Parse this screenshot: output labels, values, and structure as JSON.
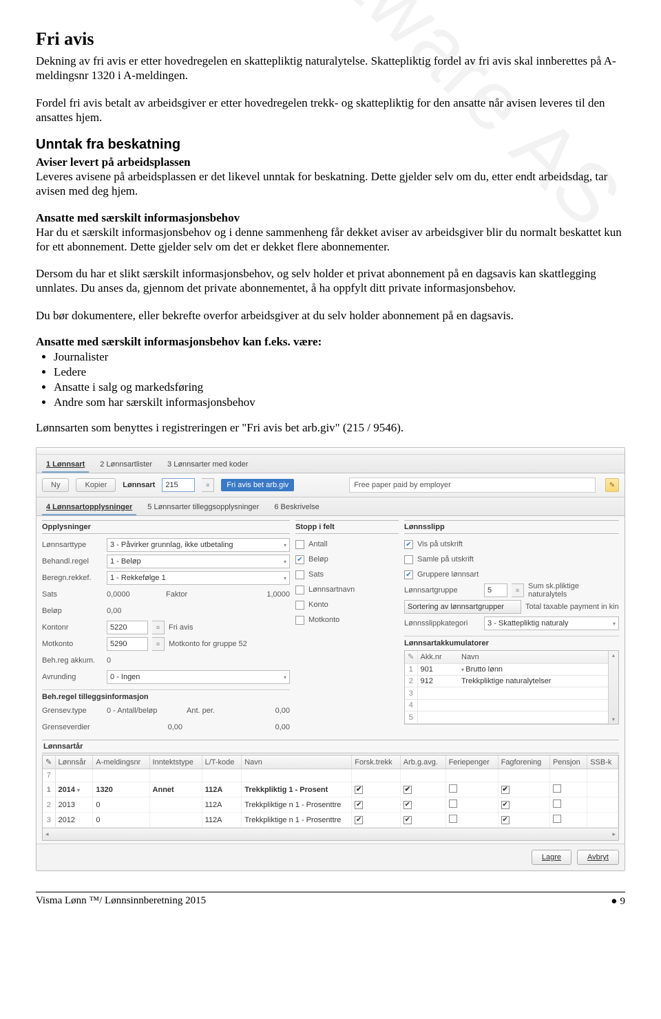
{
  "page": {
    "title": "Fri avis",
    "p1": "Dekning av fri avis er etter hovedregelen en skattepliktig naturalytelse. Skattepliktig fordel av fri avis skal innberettes på A-meldingsnr 1320 i A-meldingen.",
    "p2": "Fordel fri avis betalt av arbeidsgiver er etter hovedregelen trekk- og skattepliktig for den ansatte når avisen leveres til den ansattes hjem.",
    "h2": "Unntak fra beskatning",
    "h3a": "Aviser levert på arbeidsplassen",
    "p3": "Leveres avisene på arbeidsplassen er det likevel unntak for beskatning. Dette gjelder selv om du, etter endt arbeidsdag, tar avisen med deg hjem.",
    "h3b": "Ansatte med særskilt informasjonsbehov",
    "p4": "Har du et særskilt informasjonsbehov og i denne sammenheng får dekket aviser av arbeidsgiver blir du normalt beskattet kun for ett abonnement. Dette gjelder selv om det er dekket flere abonnementer.",
    "p5": "Dersom du har et slikt særskilt informasjonsbehov, og selv holder et privat abonnement på en dagsavis kan skattlegging unnlates. Du anses da, gjennom det private abonnementet, å ha oppfylt ditt private informasjonsbehov.",
    "p6": "Du bør dokumentere, eller bekrefte overfor arbeidsgiver at du selv holder abonnement på en dagsavis.",
    "h3c": "Ansatte med særskilt informasjonsbehov kan f.eks. være:",
    "bullets": [
      "Journalister",
      "Ledere",
      "Ansatte i salg og markedsføring",
      "Andre som har særskilt informasjonsbehov"
    ],
    "p7": "Lønnsarten som benyttes i registreringen er \"Fri avis bet arb.giv\" (215 / 9546).",
    "footer_left": "Visma Lønn ™/ Lønnsinnberetning 2015",
    "footer_right": "9",
    "watermark": "Visma Software AS"
  },
  "app": {
    "top_tabs": [
      "1 Lønnsart",
      "2 Lønnsartlister",
      "3 Lønnsarter med koder"
    ],
    "toolbar": {
      "ny": "Ny",
      "kopier": "Kopier",
      "lbl": "Lønnsart",
      "num": "215",
      "seltag": "Fri avis bet arb.giv",
      "free": "Free paper paid by employer"
    },
    "sub_tabs": [
      "4 Lønnsartopplysninger",
      "5 Lønnsarter tilleggsopplysninger",
      "6 Beskrivelse"
    ],
    "left": {
      "title": "Opplysninger",
      "rows": [
        {
          "n": "Lønnsarttype",
          "v": "3 - Påvirker grunnlag, ikke utbetaling",
          "dd": true
        },
        {
          "n": "Behandl.regel",
          "v": "1 - Beløp",
          "dd": true
        },
        {
          "n": "Beregn.rekkef.",
          "v": "1 - Rekkefølge 1",
          "dd": true
        },
        {
          "n": "Sats",
          "v": "0,0000",
          "extra_lbl": "Faktor",
          "extra_v": "1,0000"
        },
        {
          "n": "Beløp",
          "v": "0,00"
        },
        {
          "n": "Kontonr",
          "v": "5220",
          "list": true,
          "gray": "Fri avis"
        },
        {
          "n": "Motkonto",
          "v": "5290",
          "list": true,
          "gray": "Motkonto for gruppe 52"
        },
        {
          "n": "Beh.reg akkum.",
          "v": "0"
        },
        {
          "n": "Avrunding",
          "v": "0 - Ingen",
          "dd": true
        }
      ],
      "sub": "Beh.regel tilleggsinformasjon",
      "subrows": [
        {
          "n": "Grensev.type",
          "v": "0 - Antall/beløp",
          "extra_lbl": "Ant. per.",
          "extra_v": "0,00"
        },
        {
          "n": "Grenseverdier",
          "v": "",
          "extra_lbl": "0,00",
          "extra_v": "0,00"
        }
      ]
    },
    "mid": {
      "title": "Stopp i felt",
      "checks": [
        {
          "l": "Antall",
          "c": false
        },
        {
          "l": "Beløp",
          "c": true
        },
        {
          "l": "Sats",
          "c": false
        },
        {
          "l": "Lønnsartnavn",
          "c": false
        },
        {
          "l": "Konto",
          "c": false
        },
        {
          "l": "Motkonto",
          "c": false
        }
      ]
    },
    "right": {
      "title": "Lønnsslipp",
      "checks": [
        {
          "l": "Vis på utskrift",
          "c": true
        },
        {
          "l": "Samle på utskrift",
          "c": false
        },
        {
          "l": "Gruppere lønnsart",
          "c": true
        }
      ],
      "grpnum_lbl": "Lønnsartgruppe",
      "grpnum": "5",
      "grpnum_gray": "Sum sk.pliktige naturalytels",
      "sortbtn": "Sortering av lønnsartgrupper",
      "sortgray": "Total taxable payment in kin",
      "kat_lbl": "Lønnsslippkategori",
      "kat": "3 - Skattepliktig naturaly",
      "akk_title": "Lønnsartakkumulatorer",
      "akk_head": [
        "Akk.nr",
        "Navn"
      ],
      "akk_rows": [
        {
          "nr": "901",
          "navn": "Brutto lønn"
        },
        {
          "nr": "912",
          "navn": "Trekkpliktige naturalytelser"
        }
      ]
    },
    "la": {
      "title": "Lønnsartår",
      "cols": [
        "Lønnsår",
        "A-meldingsnr",
        "Inntektstype",
        "L/T-kode",
        "Navn",
        "Forsk.trekk",
        "Arb.g.avg.",
        "Feriepenger",
        "Fagforening",
        "Pensjon",
        "SSB-k"
      ],
      "rows": [
        {
          "n": "7",
          "y": "",
          "am": "",
          "it": "",
          "lt": "",
          "nv": "",
          "ft": "",
          "ag": "",
          "fp": "",
          "fg": "",
          "pe": ""
        },
        {
          "n": "1",
          "y": "2014",
          "am": "1320",
          "it": "Annet",
          "lt": "112A",
          "nv": "Trekkpliktig 1 - Prosent",
          "ft": "y",
          "ag": "y",
          "fp": "",
          "fg": "y",
          "pe": "",
          "sel": true
        },
        {
          "n": "2",
          "y": "2013",
          "am": "0",
          "it": "",
          "lt": "112A",
          "nv": "Trekkpliktige n 1 - Prosenttre",
          "ft": "y",
          "ag": "y",
          "fp": "",
          "fg": "y",
          "pe": ""
        },
        {
          "n": "3",
          "y": "2012",
          "am": "0",
          "it": "",
          "lt": "112A",
          "nv": "Trekkpliktige n 1 - Prosenttre",
          "ft": "y",
          "ag": "y",
          "fp": "",
          "fg": "y",
          "pe": ""
        }
      ]
    },
    "buttons": {
      "save": "Lagre",
      "cancel": "Avbryt"
    }
  }
}
